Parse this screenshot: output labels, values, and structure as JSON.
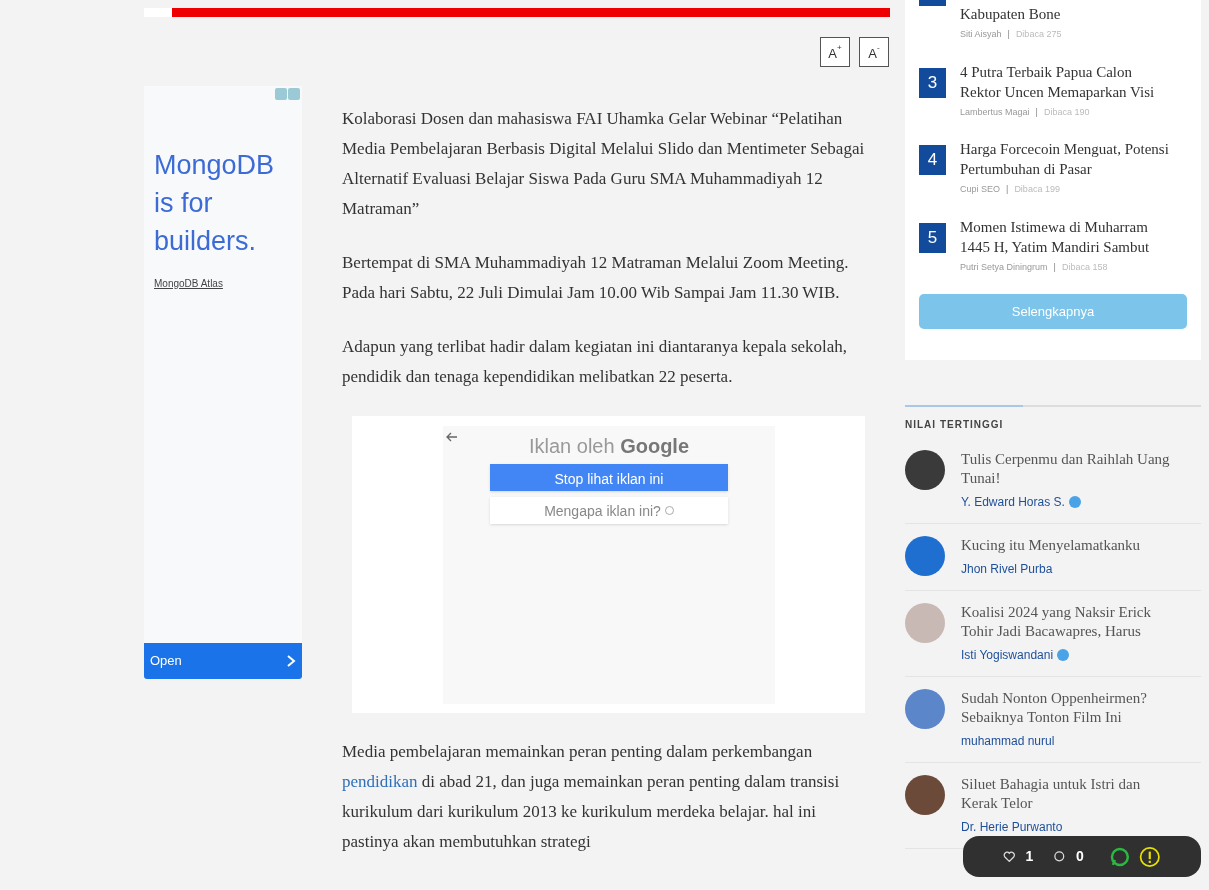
{
  "font_buttons": [
    {
      "label": "A",
      "mark": "+"
    },
    {
      "label": "A",
      "mark": "-"
    }
  ],
  "ad": {
    "headline": "MongoDB is for builders.",
    "link": "MongoDB Atlas",
    "cta": "Open"
  },
  "article": {
    "paragraphs_top": [
      "Kolaborasi Dosen dan mahasiswa FAI Uhamka Gelar Webinar “Pelatihan Media Pembelajaran Berbasis Digital Melalui Slido dan Mentimeter Sebagai Alternatif Evaluasi Belajar Siswa Pada Guru SMA Muhammadiyah 12 Matraman”",
      "Bertempat di SMA Muhammadiyah 12 Matraman Melalui Zoom Meeting. Pada hari Sabtu, 22 Juli Dimulai Jam 10.00 Wib Sampai Jam 11.30 WIB.",
      "Adapun yang terlibat hadir dalam kegiatan ini diantaranya kepala sekolah, pendidik dan tenaga kependidikan melibatkan 22 peserta."
    ],
    "ad_notice": {
      "title": "Iklan oleh",
      "brand": "Google",
      "primary": "Stop lihat iklan ini",
      "secondary": "Mengapa iklan ini?"
    },
    "last_paragraph": {
      "before": "Media pembelajaran memainkan peran penting dalam perkembangan ",
      "link": "pendidikan",
      "after": " di abad 21, dan juga memainkan peran penting dalam transisi kurikulum dari kurikulum 2013 ke kurikulum merdeka belajar. hal ini pastinya akan membutuhkan strategi"
    }
  },
  "popular": {
    "items": [
      {
        "title": "Kabupaten Bone",
        "author": "Siti Aisyah",
        "reads": "Dibaca 275"
      },
      {
        "number": "3",
        "title": "4 Putra Terbaik Papua Calon Rektor Uncen Memaparkan Visi",
        "author": "Lambertus Magai",
        "reads": "Dibaca 190"
      },
      {
        "number": "4",
        "title": "Harga Forcecoin Menguat, Potensi Pertumbuhan di Pasar",
        "author": "Cupi SEO",
        "reads": "Dibaca 199"
      },
      {
        "number": "5",
        "title": "Momen Istimewa di Muharram 1445 H, Yatim Mandiri Sambut",
        "author": "Putri Setya Diningrum",
        "reads": "Dibaca 158"
      }
    ],
    "separator": "|",
    "more": "Selengkapnya"
  },
  "top_rated": {
    "heading": "NILAI TERTINGGI",
    "items": [
      {
        "title": "Tulis Cerpenmu dan Raihlah Uang Tunai!",
        "author": "Y. Edward Horas S.",
        "verified": true,
        "color": "#3a3a3a"
      },
      {
        "title": "Kucing itu Menyelamatkanku",
        "author": "Jhon Rivel Purba",
        "verified": false,
        "color": "#1e6fd0"
      },
      {
        "title": "Koalisi 2024 yang Naksir Erick Tohir Jadi Bacawapres, Harus",
        "author": "Isti Yogiswandani",
        "verified": true,
        "color": "#c9b9b4"
      },
      {
        "title": "Sudah Nonton Oppenheirmen? Sebaiknya Tonton Film Ini",
        "author": "muhammad nurul",
        "verified": false,
        "color": "#5b86c9"
      },
      {
        "title": "Siluet Bahagia untuk Istri dan Kerak Telor",
        "author": "Dr. Herie Purwanto",
        "verified": false,
        "color": "#6b4a3a"
      }
    ]
  },
  "action_bar": {
    "likes": "1",
    "comments": "0"
  }
}
